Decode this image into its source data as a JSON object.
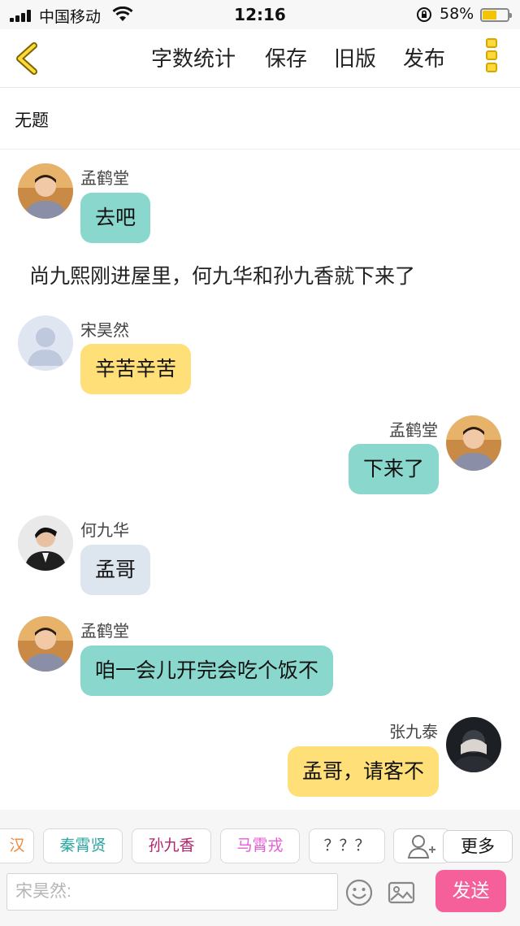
{
  "status_bar": {
    "carrier": "中国移动",
    "time": "12:16",
    "battery": "58%",
    "battery_level": 0.58
  },
  "nav": {
    "word_count": "字数统计",
    "save": "保存",
    "old_version": "旧版",
    "publish": "发布",
    "icons": [
      "chevron-left-icon",
      "more-vertical-icon"
    ]
  },
  "doc": {
    "title": "无题"
  },
  "messages": [
    {
      "speaker": "孟鹤堂",
      "text": "去吧",
      "side": "left",
      "bubble_color": "#8ad7cd"
    },
    {
      "narration": "尚九熙刚进屋里，何九华和孙九香就下来了"
    },
    {
      "speaker": "宋昊然",
      "text": "辛苦辛苦",
      "side": "left",
      "bubble_color": "#ffdf78"
    },
    {
      "speaker": "孟鹤堂",
      "text": "下来了",
      "side": "right",
      "bubble_color": "#8ad7cd"
    },
    {
      "speaker": "何九华",
      "text": "孟哥",
      "side": "left",
      "bubble_color": "#dde5ef"
    },
    {
      "speaker": "孟鹤堂",
      "text": "咱一会儿开完会吃个饭不",
      "side": "left",
      "bubble_color": "#8ad7cd"
    },
    {
      "speaker": "张九泰",
      "text": "孟哥，请客不",
      "side": "right",
      "bubble_color": "#ffdf78"
    }
  ],
  "character_chips": [
    {
      "label": "汉",
      "color": "#f0883a"
    },
    {
      "label": "秦霄贤",
      "color": "#2aa7a0"
    },
    {
      "label": "孙九香",
      "color": "#b0246c"
    },
    {
      "label": "马霄戎",
      "color": "#e85cd6"
    },
    {
      "label": "？？？",
      "color": "#444444"
    }
  ],
  "add_character_icon": "add-user-icon",
  "more_label": "更多",
  "input": {
    "placeholder": "宋昊然:"
  },
  "send_label": "发送",
  "colors": {
    "send_button": "#f5609a",
    "more_icon": "#ffd83a"
  }
}
